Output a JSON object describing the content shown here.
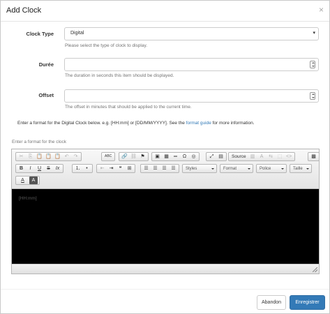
{
  "dialog": {
    "title": "Add Clock",
    "close_glyph": "×"
  },
  "form": {
    "clock_type": {
      "label": "Clock Type",
      "value": "Digital",
      "help": "Please select the type of clock to display."
    },
    "duration": {
      "label": "Durée",
      "value": "",
      "help": "The duration in seconds this item should be displayed."
    },
    "offset": {
      "label": "Offset",
      "value": "",
      "help": "The offset in minutes that should be applied to the current time."
    },
    "format_info": {
      "prefix": "Enter a format for the Digital Clock below. e.g. [HH:mm] or [DD/MM/YYYY]. See the ",
      "link": "format guide",
      "suffix": " for more information."
    }
  },
  "editor": {
    "label": "Enter a format for the clock",
    "content": "[HH:mm]",
    "toolbar": {
      "row1": [
        {
          "name": "cut",
          "glyph": "✂",
          "disabled": true
        },
        {
          "name": "copy",
          "glyph": "⎘",
          "disabled": true
        },
        {
          "name": "paste",
          "glyph": "📋",
          "disabled": false
        },
        {
          "name": "paste-text",
          "glyph": "📋",
          "disabled": false
        },
        {
          "name": "paste-word",
          "glyph": "📋",
          "disabled": false
        },
        {
          "name": "undo",
          "glyph": "↶",
          "disabled": true
        },
        {
          "name": "redo",
          "glyph": "↷",
          "disabled": true
        },
        {
          "name": "spellcheck",
          "glyph": "ABC",
          "disabled": false
        },
        {
          "name": "link",
          "glyph": "🔗",
          "disabled": false
        },
        {
          "name": "unlink",
          "glyph": "⛓",
          "disabled": true
        },
        {
          "name": "anchor",
          "glyph": "⚑",
          "disabled": false
        },
        {
          "name": "image",
          "glyph": "▣",
          "disabled": false
        },
        {
          "name": "table",
          "glyph": "▦",
          "disabled": false
        },
        {
          "name": "horizontal-rule",
          "glyph": "═",
          "disabled": false
        },
        {
          "name": "special-char",
          "glyph": "Ω",
          "disabled": false
        },
        {
          "name": "iframe",
          "glyph": "◎",
          "disabled": false
        },
        {
          "name": "maximize",
          "glyph": "⤢",
          "disabled": false
        },
        {
          "name": "show-blocks",
          "glyph": "▤",
          "disabled": false
        },
        {
          "name": "source",
          "glyph": "Source",
          "disabled": false
        },
        {
          "name": "templates",
          "glyph": "▥",
          "disabled": true
        },
        {
          "name": "find",
          "glyph": "A",
          "disabled": true
        },
        {
          "name": "replace",
          "glyph": "⇆",
          "disabled": true
        },
        {
          "name": "select-all",
          "glyph": "⬚",
          "disabled": true
        },
        {
          "name": "code",
          "glyph": "<>",
          "disabled": true
        },
        {
          "name": "qr",
          "glyph": "▩",
          "disabled": false
        }
      ],
      "row2": [
        {
          "name": "bold",
          "glyph": "B"
        },
        {
          "name": "italic",
          "glyph": "I"
        },
        {
          "name": "underline",
          "glyph": "U"
        },
        {
          "name": "strike",
          "glyph": "S"
        },
        {
          "name": "remove-format",
          "glyph": "Ix"
        },
        {
          "name": "numbered-list",
          "glyph": "⒈"
        },
        {
          "name": "bulleted-list",
          "glyph": "•"
        },
        {
          "name": "outdent",
          "glyph": "⇤"
        },
        {
          "name": "indent",
          "glyph": "⇥"
        },
        {
          "name": "blockquote",
          "glyph": "❝"
        },
        {
          "name": "creatediv",
          "glyph": "⊞"
        },
        {
          "name": "align-left",
          "glyph": "☰"
        },
        {
          "name": "align-center",
          "glyph": "☰"
        },
        {
          "name": "align-right",
          "glyph": "☰"
        },
        {
          "name": "justify",
          "glyph": "☰"
        }
      ],
      "combos": {
        "styles": "Styles",
        "format": "Format",
        "font": "Police",
        "size": "Taille"
      },
      "row3": [
        {
          "name": "text-color",
          "glyph": "A"
        },
        {
          "name": "bg-color",
          "glyph": "A"
        }
      ]
    }
  },
  "footer": {
    "cancel_label": "Abandon",
    "save_label": "Enregistrer"
  },
  "colors": {
    "primary": "#337ab7",
    "editor_bg": "#000000",
    "link": "#337ab7"
  }
}
